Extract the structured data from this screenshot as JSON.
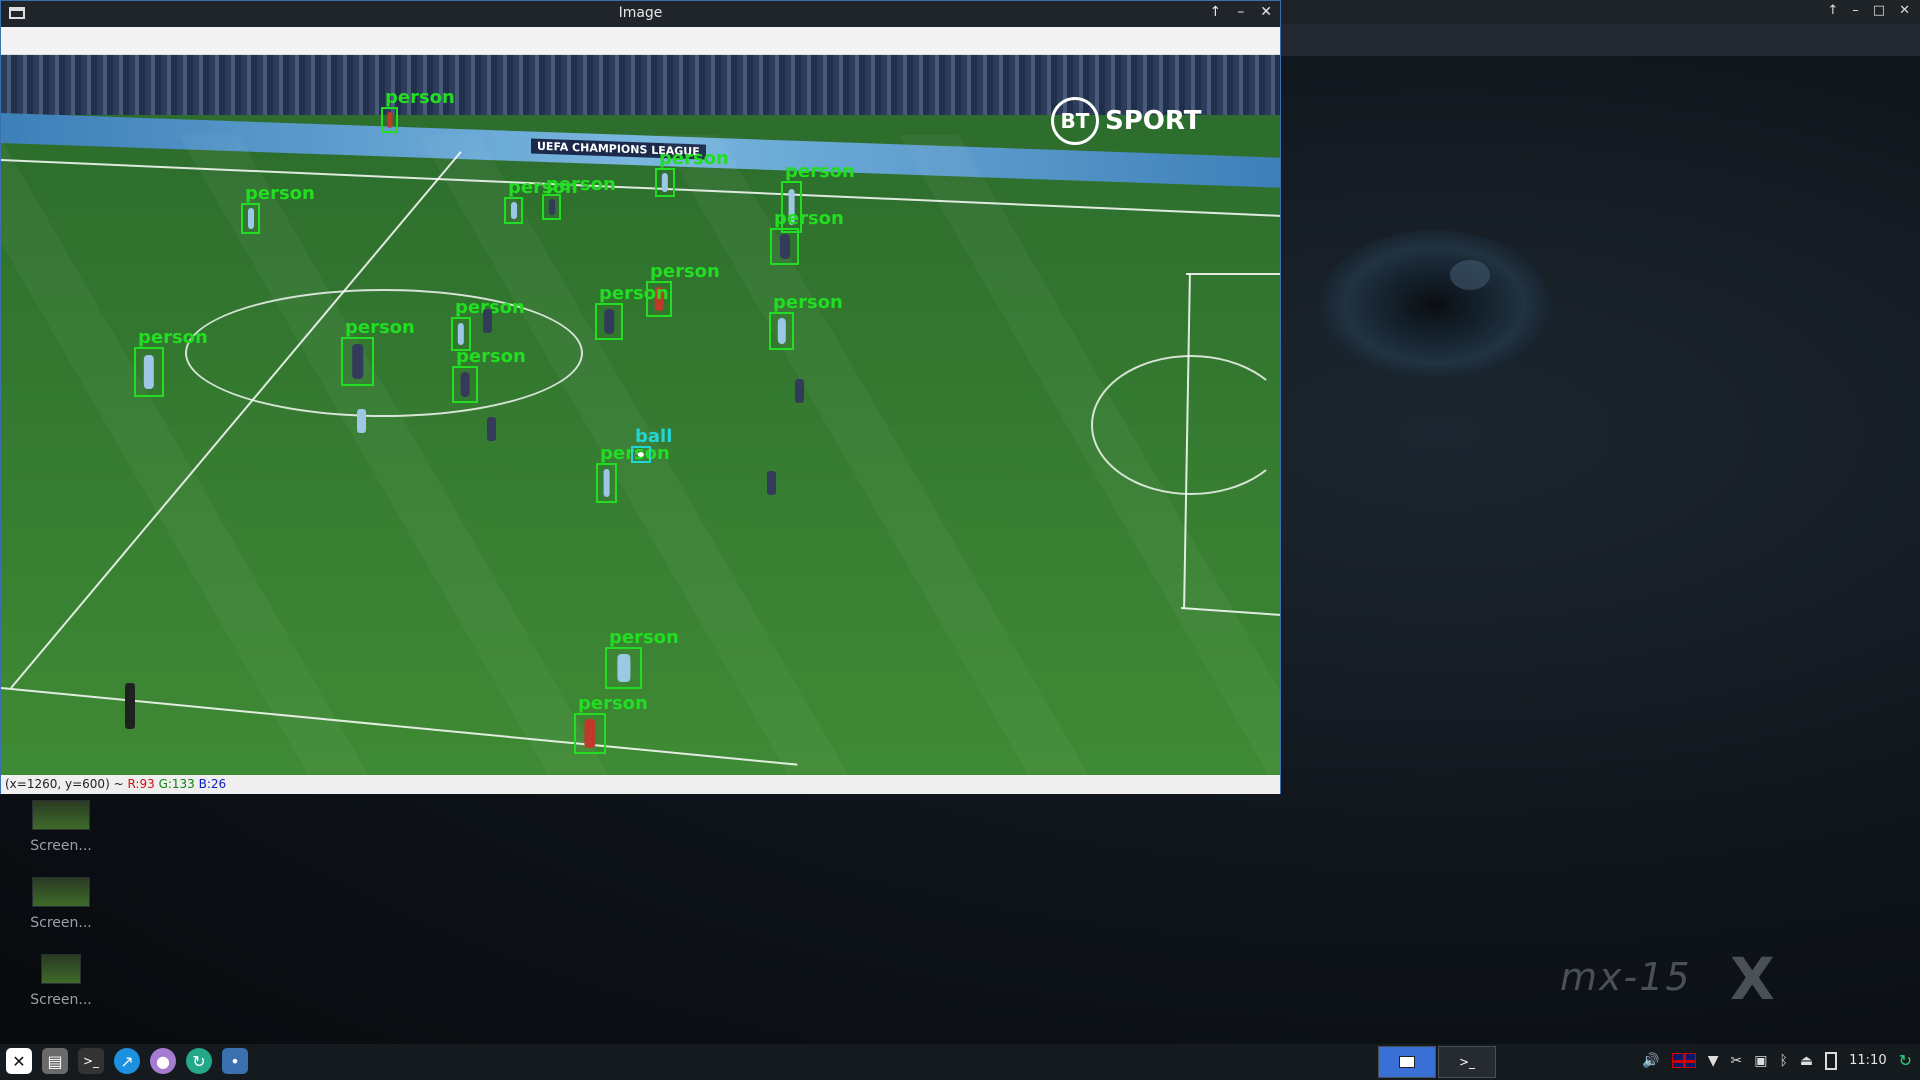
{
  "window": {
    "title": "Image",
    "status": {
      "coords": "(x=1260, y=600) ~",
      "r": "R:93",
      "g": "G:133",
      "b": "B:26"
    }
  },
  "overlay": {
    "logo": "BT SPORT",
    "logo_bt": "BT",
    "logo_sport": "SPORT",
    "banner": "UEFA CHAMPIONS LEAGUE"
  },
  "detections": [
    {
      "label": "person"
    },
    {
      "label": "person"
    },
    {
      "label": "person"
    },
    {
      "label": "person"
    },
    {
      "label": "person"
    },
    {
      "label": "person"
    },
    {
      "label": "person"
    },
    {
      "label": "person"
    },
    {
      "label": "person"
    },
    {
      "label": "person"
    },
    {
      "label": "person"
    },
    {
      "label": "person"
    },
    {
      "label": "person"
    },
    {
      "label": "person"
    },
    {
      "label": "person"
    },
    {
      "label": "person"
    },
    {
      "label": "person"
    },
    {
      "label": "ball"
    },
    {
      "label": "person"
    },
    {
      "label": "person"
    }
  ],
  "desktop": {
    "icons": [
      {
        "label": "Screen..."
      },
      {
        "label": "Screen..."
      },
      {
        "label": "Screen..."
      }
    ],
    "wallpaper_brand": "mx-15",
    "wallpaper_mark": "X"
  },
  "taskbar": {
    "clock": "11:10",
    "icons": [
      "mx-menu-icon",
      "file-manager-icon",
      "terminal-icon",
      "browser-icon",
      "paint-icon",
      "update-icon",
      "python-icon"
    ]
  }
}
